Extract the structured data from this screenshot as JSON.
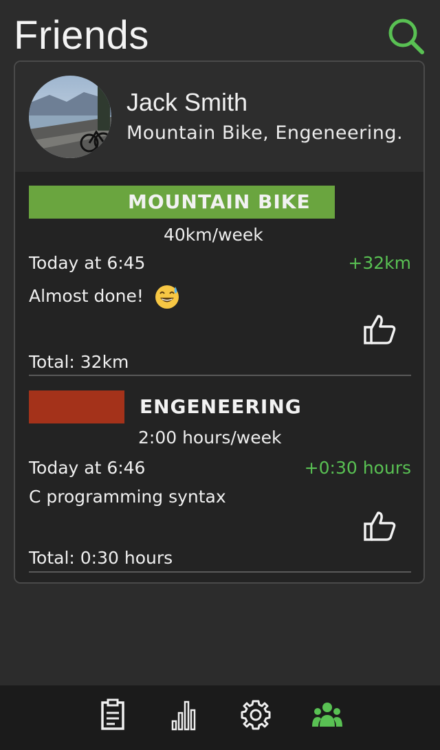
{
  "header": {
    "title": "Friends",
    "search_icon": "search-icon"
  },
  "profile": {
    "name": "Jack Smith",
    "interests": "Mountain Bike, Engeneering."
  },
  "activities": [
    {
      "title": "MOUNTAIN BIKE",
      "color": "#6aa53f",
      "goal": "40km/week",
      "time": "Today at 6:45",
      "delta": "+32km",
      "note": "Almost done!",
      "note_emoji": "grinning-face-with-sweat",
      "total": "Total: 32km"
    },
    {
      "title": "ENGENEERING",
      "color": "#a4321a",
      "goal": "2:00 hours/week",
      "time": "Today at 6:46",
      "delta": "+0:30 hours",
      "note": "C programming syntax",
      "total": "Total: 0:30 hours"
    }
  ],
  "accent_green": "#59c153",
  "nav": [
    {
      "name": "clipboard-icon",
      "active": false
    },
    {
      "name": "bar-chart-icon",
      "active": false
    },
    {
      "name": "settings-icon",
      "active": false
    },
    {
      "name": "friends-icon",
      "active": true
    }
  ]
}
